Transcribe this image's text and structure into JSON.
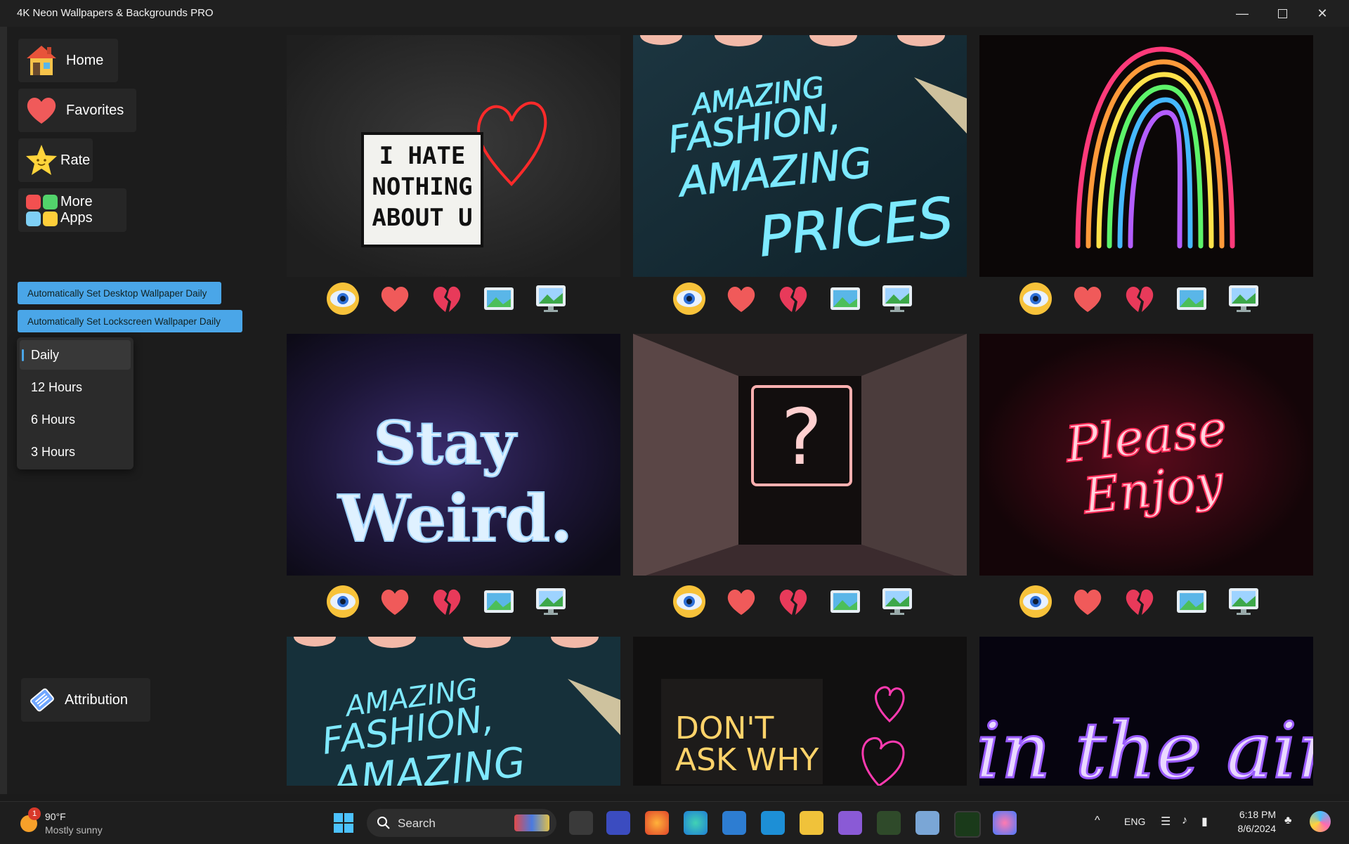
{
  "window": {
    "title": "4K Neon Wallpapers & Backgrounds PRO",
    "minimize_icon": "minimize-icon",
    "maximize_icon": "maximize-icon",
    "close_icon": "close-icon"
  },
  "sidebar": {
    "nav": [
      {
        "label": "Home",
        "icon": "house-icon"
      },
      {
        "label": "Favorites",
        "icon": "heart-icon"
      },
      {
        "label": "Rate",
        "icon": "star-icon"
      },
      {
        "label": "More Apps",
        "icon": "apps-grid-icon"
      }
    ],
    "auto_desktop": "Automatically Set Desktop Wallpaper Daily",
    "auto_lockscreen": "Automatically Set Lockscreen Wallpaper Daily",
    "interval_options": [
      "Daily",
      "12 Hours",
      "6 Hours",
      "3 Hours"
    ],
    "interval_selected": "Daily",
    "attribution": "Attribution"
  },
  "gallery": {
    "tile_actions": [
      "eye-icon",
      "heart-icon",
      "broken-heart-icon",
      "set-desktop-icon",
      "set-lockscreen-icon"
    ],
    "tiles": [
      {
        "name": "wallpaper-i-hate-nothing",
        "lines": [
          "I HATE",
          "NOTHING",
          "ABOUT U"
        ]
      },
      {
        "name": "wallpaper-amazing-fashion",
        "lines": [
          "AMAZING",
          "FASHION,",
          "AMAZING",
          "PRICES"
        ]
      },
      {
        "name": "wallpaper-neon-rainbow",
        "lines": []
      },
      {
        "name": "wallpaper-stay-weird",
        "lines": [
          "Stay",
          "Weird."
        ]
      },
      {
        "name": "wallpaper-question-mark",
        "lines": [
          "?"
        ]
      },
      {
        "name": "wallpaper-please-enjoy",
        "lines": [
          "Please",
          "Enjoy"
        ]
      },
      {
        "name": "wallpaper-amazing-fashion-2",
        "lines": [
          "AMAZING",
          "FASHION,",
          "AMAZING"
        ]
      },
      {
        "name": "wallpaper-dont-ask-why",
        "lines": [
          "DON'T",
          "ASK WHY"
        ]
      },
      {
        "name": "wallpaper-in-the-air",
        "lines": [
          "in the air"
        ]
      }
    ]
  },
  "taskbar": {
    "weather_temp": "90°F",
    "weather_desc": "Mostly sunny",
    "weather_badge": "1",
    "search_placeholder": "Search",
    "language": "ENG",
    "time": "6:18 PM",
    "date": "8/6/2024",
    "accent": "#4aa6e8"
  }
}
